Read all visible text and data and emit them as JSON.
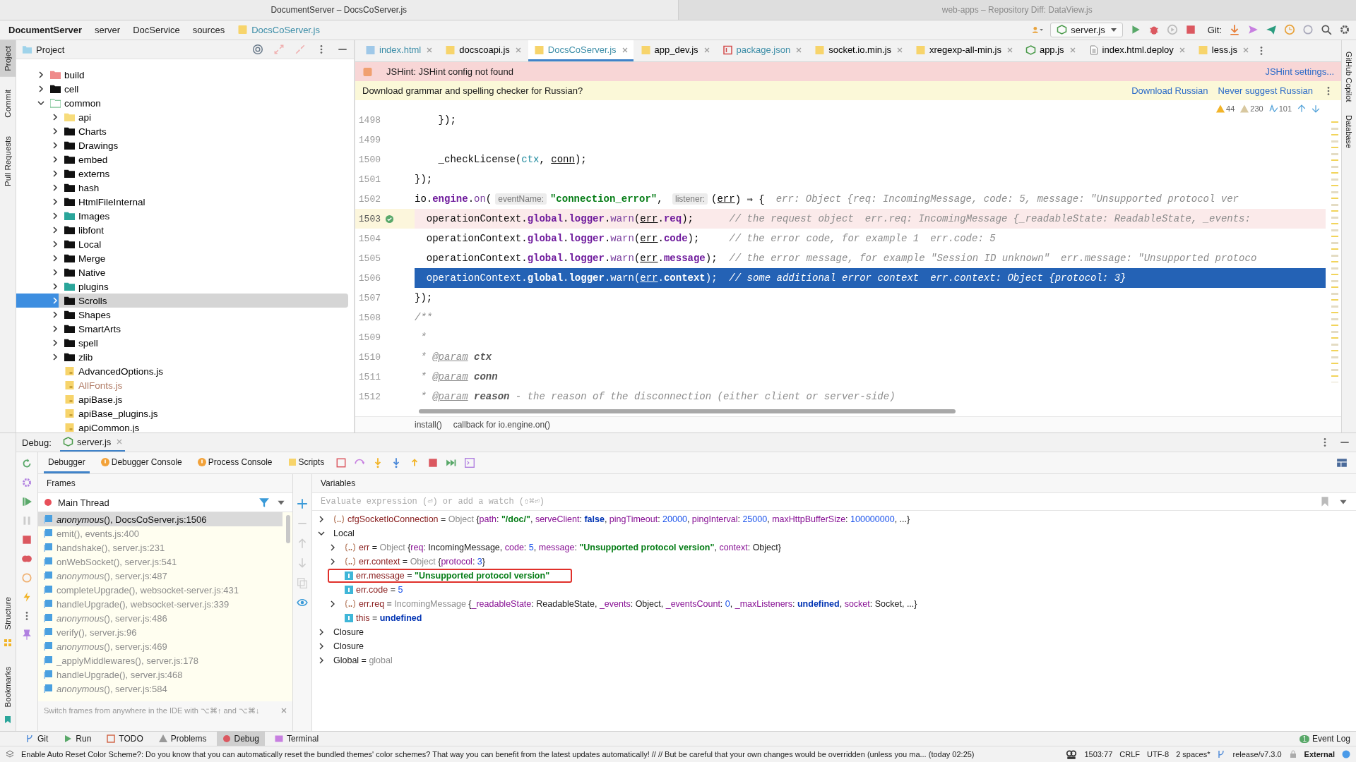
{
  "window_titles": [
    {
      "text": "DocumentServer – DocsCoServer.js",
      "selected": true
    },
    {
      "text": "web-apps – Repository Diff: DataView.js",
      "selected": false
    }
  ],
  "breadcrumbs": [
    {
      "label": "DocumentServer",
      "kind": "project"
    },
    {
      "label": "server",
      "kind": "dir"
    },
    {
      "label": "DocService",
      "kind": "dir"
    },
    {
      "label": "sources",
      "kind": "dir"
    },
    {
      "label": "DocsCoServer.js",
      "kind": "file"
    }
  ],
  "run_config": {
    "label": "server.js"
  },
  "git_label": "Git:",
  "left_stripe": [
    {
      "label": "Project",
      "selected": true
    },
    {
      "label": "Commit",
      "selected": false
    },
    {
      "label": "Pull Requests",
      "selected": false
    }
  ],
  "left_stripe_bottom": [
    {
      "label": "Structure",
      "kind": "structure"
    },
    {
      "label": "Bookmarks",
      "kind": "bookmarks"
    }
  ],
  "right_stripe": [
    {
      "label": "GitHub Copilot"
    },
    {
      "label": "Database"
    }
  ],
  "project": {
    "title": "Project",
    "tree": [
      {
        "label": "build",
        "kind": "excluded",
        "expanded": false,
        "selected": false,
        "color": "#000000"
      },
      {
        "label": "cell",
        "kind": "folder",
        "expanded": false,
        "selected": false,
        "color": "#000000"
      },
      {
        "label": "common",
        "kind": "module",
        "expanded": true,
        "selected": false,
        "color": "#000000",
        "children": [
          {
            "label": "api",
            "kind": "package",
            "expanded": false,
            "selected": false,
            "color": "#000000"
          },
          {
            "label": "Charts",
            "kind": "folder",
            "expanded": false,
            "selected": false,
            "color": "#000000"
          },
          {
            "label": "Drawings",
            "kind": "folder",
            "expanded": false,
            "selected": false,
            "color": "#000000"
          },
          {
            "label": "embed",
            "kind": "folder",
            "expanded": false,
            "selected": false,
            "color": "#000000"
          },
          {
            "label": "externs",
            "kind": "folder",
            "expanded": false,
            "selected": false,
            "color": "#000000"
          },
          {
            "label": "hash",
            "kind": "folder",
            "expanded": false,
            "selected": false,
            "color": "#000000"
          },
          {
            "label": "HtmlFileInternal",
            "kind": "folder",
            "expanded": false,
            "selected": false,
            "color": "#000000"
          },
          {
            "label": "Images",
            "kind": "resource",
            "expanded": false,
            "selected": false,
            "color": "#000000"
          },
          {
            "label": "libfont",
            "kind": "folder",
            "expanded": false,
            "selected": false,
            "color": "#000000"
          },
          {
            "label": "Local",
            "kind": "folder",
            "expanded": false,
            "selected": false,
            "color": "#000000"
          },
          {
            "label": "Merge",
            "kind": "folder",
            "expanded": false,
            "selected": false,
            "color": "#000000"
          },
          {
            "label": "Native",
            "kind": "folder",
            "expanded": false,
            "selected": false,
            "color": "#000000"
          },
          {
            "label": "plugins",
            "kind": "resource",
            "expanded": false,
            "selected": false,
            "color": "#000000"
          },
          {
            "label": "Scrolls",
            "kind": "folder",
            "expanded": false,
            "selected": true,
            "color": "#000000"
          },
          {
            "label": "Shapes",
            "kind": "folder",
            "expanded": false,
            "selected": false,
            "color": "#000000"
          },
          {
            "label": "SmartArts",
            "kind": "folder",
            "expanded": false,
            "selected": false,
            "color": "#000000"
          },
          {
            "label": "spell",
            "kind": "folder",
            "expanded": false,
            "selected": false,
            "color": "#000000"
          },
          {
            "label": "zlib",
            "kind": "folder",
            "expanded": false,
            "selected": false,
            "color": "#000000"
          },
          {
            "label": "AdvancedOptions.js",
            "kind": "js",
            "selected": false,
            "color": "#000000"
          },
          {
            "label": "AllFonts.js",
            "kind": "js",
            "selected": false,
            "color": "#b07a64"
          },
          {
            "label": "apiBase.js",
            "kind": "js",
            "selected": false,
            "color": "#000000"
          },
          {
            "label": "apiBase_plugins.js",
            "kind": "js",
            "selected": false,
            "color": "#000000"
          },
          {
            "label": "apiCommon.js",
            "kind": "js",
            "selected": false,
            "color": "#000000"
          }
        ]
      }
    ]
  },
  "editor": {
    "tabs": [
      {
        "label": "index.html",
        "kind": "html",
        "selected": false,
        "color": "#3d8ea8"
      },
      {
        "label": "docscoapi.js",
        "kind": "js",
        "selected": false,
        "color": "#000000"
      },
      {
        "label": "DocsCoServer.js",
        "kind": "js",
        "selected": true,
        "color": "#3d8ea8"
      },
      {
        "label": "app_dev.js",
        "kind": "js",
        "selected": false,
        "color": "#000000"
      },
      {
        "label": "package.json",
        "kind": "json",
        "selected": false,
        "color": "#3d8ea8"
      },
      {
        "label": "socket.io.min.js",
        "kind": "js",
        "selected": false,
        "color": "#000000"
      },
      {
        "label": "xregexp-all-min.js",
        "kind": "js",
        "selected": false,
        "color": "#000000"
      },
      {
        "label": "app.js",
        "kind": "node",
        "selected": false,
        "color": "#000000"
      },
      {
        "label": "index.html.deploy",
        "kind": "text",
        "selected": false,
        "color": "#000000"
      },
      {
        "label": "less.js",
        "kind": "js",
        "selected": false,
        "color": "#000000"
      }
    ],
    "jshint": {
      "message": "JSHint: JSHint config not found",
      "link": "JSHint settings..."
    },
    "grammar": {
      "message": "Download grammar and spelling checker for Russian?",
      "actions": [
        "Download Russian",
        "Never suggest Russian"
      ]
    },
    "inspections": [
      {
        "kind": "warning",
        "count": "44"
      },
      {
        "kind": "weak",
        "count": "230"
      },
      {
        "kind": "typo",
        "count": "101"
      }
    ],
    "lines": [
      {
        "number": "1498",
        "kind": "normal",
        "segments": [
          {
            "kind": "t",
            "text": "    });"
          }
        ]
      },
      {
        "number": "1499",
        "kind": "normal"
      },
      {
        "number": "1500",
        "kind": "normal",
        "segments": [
          {
            "kind": "t",
            "text": "    _checkLicense("
          },
          {
            "kind": "l",
            "text": "ctx"
          },
          {
            "kind": "t",
            "text": ", "
          },
          {
            "kind": "p",
            "text": "conn"
          },
          {
            "kind": "t",
            "text": ");"
          }
        ]
      },
      {
        "number": "1501",
        "kind": "normal",
        "segments": [
          {
            "kind": "t",
            "text": "});"
          }
        ]
      },
      {
        "number": "1502",
        "kind": "normal",
        "segments": [
          {
            "kind": "t",
            "text": "io."
          },
          {
            "kind": "f",
            "text": "engine"
          },
          {
            "kind": "t",
            "text": "."
          },
          {
            "kind": "m",
            "text": "on"
          },
          {
            "kind": "t",
            "text": "("
          },
          {
            "kind": "h",
            "text": "eventName:"
          },
          {
            "kind": "s",
            "text": "\"connection_error\""
          },
          {
            "kind": "t",
            "text": ", "
          },
          {
            "kind": "h",
            "text": "listener:"
          },
          {
            "kind": "t",
            "text": "("
          },
          {
            "kind": "p",
            "text": "err"
          },
          {
            "kind": "t",
            "text": ") ⇒ {"
          },
          {
            "kind": "v",
            "text": "err: Object {req: IncomingMessage, code: 5, message: \"Unsupported protocol ver"
          }
        ]
      },
      {
        "number": "1503",
        "kind": "breakpoint",
        "segments": [
          {
            "kind": "t",
            "text": "  operationContext."
          },
          {
            "kind": "f",
            "text": "global"
          },
          {
            "kind": "t",
            "text": "."
          },
          {
            "kind": "f",
            "text": "logger"
          },
          {
            "kind": "t",
            "text": "."
          },
          {
            "kind": "m",
            "text": "warn"
          },
          {
            "kind": "t",
            "text": "("
          },
          {
            "kind": "p",
            "text": "err"
          },
          {
            "kind": "t",
            "text": "."
          },
          {
            "kind": "f",
            "text": "req"
          },
          {
            "kind": "t",
            "text": ");      "
          },
          {
            "kind": "c",
            "text": "// the request object"
          },
          {
            "kind": "v",
            "text": "err.req: IncomingMessage {_readableState: ReadableState, _events:"
          }
        ]
      },
      {
        "number": "1504",
        "kind": "normal",
        "segments": [
          {
            "kind": "t",
            "text": "  operationContext."
          },
          {
            "kind": "f",
            "text": "global"
          },
          {
            "kind": "t",
            "text": "."
          },
          {
            "kind": "f",
            "text": "logger"
          },
          {
            "kind": "t",
            "text": "."
          },
          {
            "kind": "m",
            "text": "warn"
          },
          {
            "kind": "t",
            "text": "("
          },
          {
            "kind": "p",
            "text": "err"
          },
          {
            "kind": "t",
            "text": "."
          },
          {
            "kind": "f",
            "text": "code"
          },
          {
            "kind": "t",
            "text": ");     "
          },
          {
            "kind": "c",
            "text": "// the error code, for example 1"
          },
          {
            "kind": "v",
            "text": "err.code: 5"
          }
        ]
      },
      {
        "number": "1505",
        "kind": "normal",
        "segments": [
          {
            "kind": "t",
            "text": "  operationContext."
          },
          {
            "kind": "f",
            "text": "global"
          },
          {
            "kind": "t",
            "text": "."
          },
          {
            "kind": "f",
            "text": "logger"
          },
          {
            "kind": "t",
            "text": "."
          },
          {
            "kind": "m",
            "text": "warn"
          },
          {
            "kind": "t",
            "text": "("
          },
          {
            "kind": "p",
            "text": "err"
          },
          {
            "kind": "t",
            "text": "."
          },
          {
            "kind": "f",
            "text": "message"
          },
          {
            "kind": "t",
            "text": ");  "
          },
          {
            "kind": "c",
            "text": "// the error message, for example \"Session ID unknown\""
          },
          {
            "kind": "v",
            "text": "err.message: \"Unsupported protoco"
          }
        ]
      },
      {
        "number": "1506",
        "kind": "execution",
        "segments": [
          {
            "kind": "t",
            "text": "  operationContext."
          },
          {
            "kind": "f",
            "text": "global"
          },
          {
            "kind": "t",
            "text": "."
          },
          {
            "kind": "f",
            "text": "logger"
          },
          {
            "kind": "t",
            "text": "."
          },
          {
            "kind": "m",
            "text": "warn"
          },
          {
            "kind": "t",
            "text": "("
          },
          {
            "kind": "p",
            "text": "err"
          },
          {
            "kind": "t",
            "text": "."
          },
          {
            "kind": "f",
            "text": "context"
          },
          {
            "kind": "t",
            "text": ");  "
          },
          {
            "kind": "c",
            "text": "// some additional error context"
          },
          {
            "kind": "v",
            "text": "err.context: Object {protocol: 3}"
          }
        ]
      },
      {
        "number": "1507",
        "kind": "normal",
        "segments": [
          {
            "kind": "t",
            "text": "});"
          }
        ]
      },
      {
        "number": "1508",
        "kind": "normal",
        "segments": [
          {
            "kind": "d",
            "text": "/**"
          }
        ]
      },
      {
        "number": "1509",
        "kind": "normal",
        "segments": [
          {
            "kind": "d",
            "text": " *"
          }
        ]
      },
      {
        "number": "1510",
        "kind": "normal",
        "segments": [
          {
            "kind": "d",
            "text": " * "
          },
          {
            "kind": "dt",
            "text": "@param"
          },
          {
            "kind": "dn",
            "text": " ctx"
          }
        ]
      },
      {
        "number": "1511",
        "kind": "normal",
        "segments": [
          {
            "kind": "d",
            "text": " * "
          },
          {
            "kind": "dt",
            "text": "@param"
          },
          {
            "kind": "dn",
            "text": " conn"
          }
        ]
      },
      {
        "number": "1512",
        "kind": "normal",
        "segments": [
          {
            "kind": "d",
            "text": " * "
          },
          {
            "kind": "dt",
            "text": "@param"
          },
          {
            "kind": "dn",
            "text": " reason"
          },
          {
            "kind": "d",
            "text": " - the reason of the disconnection (either client or server-side)"
          }
        ]
      }
    ],
    "breadcrumbs": [
      "install()",
      "callback for io.engine.on()"
    ]
  },
  "debug": {
    "label": "Debug:",
    "session": "server.js",
    "tabs": [
      {
        "label": "Debugger",
        "kind": "plain",
        "selected": true
      },
      {
        "label": "Debugger Console",
        "kind": "warning",
        "selected": false
      },
      {
        "label": "Process Console",
        "kind": "warning",
        "selected": false
      },
      {
        "label": "Scripts",
        "kind": "scripts",
        "selected": false
      }
    ],
    "frames_title": "Frames",
    "variables_title": "Variables",
    "thread": "Main Thread",
    "frames": [
      {
        "text": "*anonymous*(), DocsCoServer.js:1506",
        "selected": true
      },
      {
        "text": "emit(), events.js:400",
        "selected": false
      },
      {
        "text": "handshake(), server.js:231",
        "selected": false
      },
      {
        "text": "onWebSocket(), server.js:541",
        "selected": false
      },
      {
        "text": "*anonymous*(), server.js:487",
        "selected": false
      },
      {
        "text": "completeUpgrade(), websocket-server.js:431",
        "selected": false
      },
      {
        "text": "handleUpgrade(), websocket-server.js:339",
        "selected": false
      },
      {
        "text": "*anonymous*(), server.js:486",
        "selected": false
      },
      {
        "text": "verify(), server.js:96",
        "selected": false
      },
      {
        "text": "*anonymous*(), server.js:469",
        "selected": false
      },
      {
        "text": "_applyMiddlewares(), server.js:178",
        "selected": false
      },
      {
        "text": "handleUpgrade(), server.js:468",
        "selected": false
      },
      {
        "text": "*anonymous*(), server.js:584",
        "selected": false
      }
    ],
    "frames_hint": "Switch frames from anywhere in the IDE with ⌥⌘↑ and ⌥⌘↓",
    "watch_placeholder": "Evaluate expression (⏎) or add a watch (⇧⌘⏎)",
    "variables": [
      {
        "kind": "object",
        "expanded": false,
        "highlighted": false,
        "segments": [
          {
            "kind": "name",
            "text": "cfgSocketIoConnection"
          },
          {
            "kind": "t",
            "text": " = "
          },
          {
            "kind": "type",
            "text": "Object "
          },
          {
            "kind": "t",
            "text": "{"
          },
          {
            "kind": "key",
            "text": "path"
          },
          {
            "kind": "t",
            "text": ": "
          },
          {
            "kind": "str",
            "text": "\"/doc/\""
          },
          {
            "kind": "t",
            "text": ", "
          },
          {
            "kind": "key",
            "text": "serveClient"
          },
          {
            "kind": "t",
            "text": ": "
          },
          {
            "kind": "kw",
            "text": "false"
          },
          {
            "kind": "t",
            "text": ", "
          },
          {
            "kind": "key",
            "text": "pingTimeout"
          },
          {
            "kind": "t",
            "text": ": "
          },
          {
            "kind": "num",
            "text": "20000"
          },
          {
            "kind": "t",
            "text": ", "
          },
          {
            "kind": "key",
            "text": "pingInterval"
          },
          {
            "kind": "t",
            "text": ": "
          },
          {
            "kind": "num",
            "text": "25000"
          },
          {
            "kind": "t",
            "text": ", "
          },
          {
            "kind": "key",
            "text": "maxHttpBufferSize"
          },
          {
            "kind": "t",
            "text": ": "
          },
          {
            "kind": "num",
            "text": "100000000"
          },
          {
            "kind": "t",
            "text": ", ...}"
          }
        ]
      },
      {
        "kind": "scope",
        "expanded": true,
        "highlighted": false,
        "segments": [
          {
            "kind": "t",
            "text": "Local"
          }
        ],
        "children": [
          {
            "kind": "object",
            "expanded": false,
            "highlighted": false,
            "segments": [
              {
                "kind": "name",
                "text": "err"
              },
              {
                "kind": "t",
                "text": " = "
              },
              {
                "kind": "type",
                "text": "Object "
              },
              {
                "kind": "t",
                "text": "{"
              },
              {
                "kind": "key",
                "text": "req"
              },
              {
                "kind": "t",
                "text": ": IncomingMessage, "
              },
              {
                "kind": "key",
                "text": "code"
              },
              {
                "kind": "t",
                "text": ": "
              },
              {
                "kind": "num",
                "text": "5"
              },
              {
                "kind": "t",
                "text": ", "
              },
              {
                "kind": "key",
                "text": "message"
              },
              {
                "kind": "t",
                "text": ": "
              },
              {
                "kind": "str",
                "text": "\"Unsupported protocol version\""
              },
              {
                "kind": "t",
                "text": ", "
              },
              {
                "kind": "key",
                "text": "context"
              },
              {
                "kind": "t",
                "text": ": Object}"
              }
            ]
          },
          {
            "kind": "object",
            "expanded": false,
            "highlighted": false,
            "segments": [
              {
                "kind": "name",
                "text": "err.context"
              },
              {
                "kind": "t",
                "text": " = "
              },
              {
                "kind": "type",
                "text": "Object "
              },
              {
                "kind": "t",
                "text": "{"
              },
              {
                "kind": "key",
                "text": "protocol"
              },
              {
                "kind": "t",
                "text": ": "
              },
              {
                "kind": "num",
                "text": "3"
              },
              {
                "kind": "t",
                "text": "}"
              }
            ]
          },
          {
            "kind": "primitive",
            "highlighted": true,
            "segments": [
              {
                "kind": "name",
                "text": "err.message"
              },
              {
                "kind": "t",
                "text": " = "
              },
              {
                "kind": "str",
                "text": "\"Unsupported protocol version\""
              }
            ]
          },
          {
            "kind": "primitive",
            "highlighted": false,
            "segments": [
              {
                "kind": "name",
                "text": "err.code"
              },
              {
                "kind": "t",
                "text": " = "
              },
              {
                "kind": "num",
                "text": "5"
              }
            ]
          },
          {
            "kind": "object",
            "expanded": false,
            "highlighted": false,
            "segments": [
              {
                "kind": "name",
                "text": "err.req"
              },
              {
                "kind": "t",
                "text": " = "
              },
              {
                "kind": "type",
                "text": "IncomingMessage "
              },
              {
                "kind": "t",
                "text": "{"
              },
              {
                "kind": "key",
                "text": "_readableState"
              },
              {
                "kind": "t",
                "text": ": ReadableState, "
              },
              {
                "kind": "key",
                "text": "_events"
              },
              {
                "kind": "t",
                "text": ": Object, "
              },
              {
                "kind": "key",
                "text": "_eventsCount"
              },
              {
                "kind": "t",
                "text": ": "
              },
              {
                "kind": "num",
                "text": "0"
              },
              {
                "kind": "t",
                "text": ", "
              },
              {
                "kind": "key",
                "text": "_maxListeners"
              },
              {
                "kind": "t",
                "text": ": "
              },
              {
                "kind": "kw",
                "text": "undefined"
              },
              {
                "kind": "t",
                "text": ", "
              },
              {
                "kind": "key",
                "text": "socket"
              },
              {
                "kind": "t",
                "text": ": Socket, ...}"
              }
            ]
          },
          {
            "kind": "primitive",
            "highlighted": false,
            "segments": [
              {
                "kind": "name",
                "text": "this"
              },
              {
                "kind": "t",
                "text": " = "
              },
              {
                "kind": "kw",
                "text": "undefined"
              }
            ]
          }
        ]
      },
      {
        "kind": "scope",
        "expanded": false,
        "highlighted": false,
        "segments": [
          {
            "kind": "t",
            "text": "Closure"
          }
        ]
      },
      {
        "kind": "scope",
        "expanded": false,
        "highlighted": false,
        "segments": [
          {
            "kind": "t",
            "text": "Closure"
          }
        ]
      },
      {
        "kind": "scope",
        "expanded": false,
        "highlighted": false,
        "segments": [
          {
            "kind": "t",
            "text": "Global"
          },
          {
            "kind": "t",
            "text": " = "
          },
          {
            "kind": "type",
            "text": "global"
          }
        ]
      }
    ]
  },
  "tool_tabs": [
    {
      "label": "Git",
      "kind": "git",
      "selected": false
    },
    {
      "label": "Run",
      "kind": "run",
      "selected": false
    },
    {
      "label": "TODO",
      "kind": "todo",
      "selected": false
    },
    {
      "label": "Problems",
      "kind": "problems",
      "selected": false
    },
    {
      "label": "Debug",
      "kind": "debug",
      "selected": true
    },
    {
      "label": "Terminal",
      "kind": "terminal",
      "selected": false
    }
  ],
  "event_log": {
    "label": "Event Log",
    "count": "1"
  },
  "status_bar": {
    "message": "Enable Auto Reset Color Scheme?: Do you know that you can automatically reset the bundled themes' color schemes? That way you can benefit from the latest updates automatically! // // But be careful that your own changes would be overridden (unless you ma... (today 02:25)",
    "position": "1503:77",
    "line_separator": "CRLF",
    "encoding": "UTF-8",
    "indent": "2 spaces*",
    "branch": "release/v7.3.0",
    "scheme": "External"
  }
}
